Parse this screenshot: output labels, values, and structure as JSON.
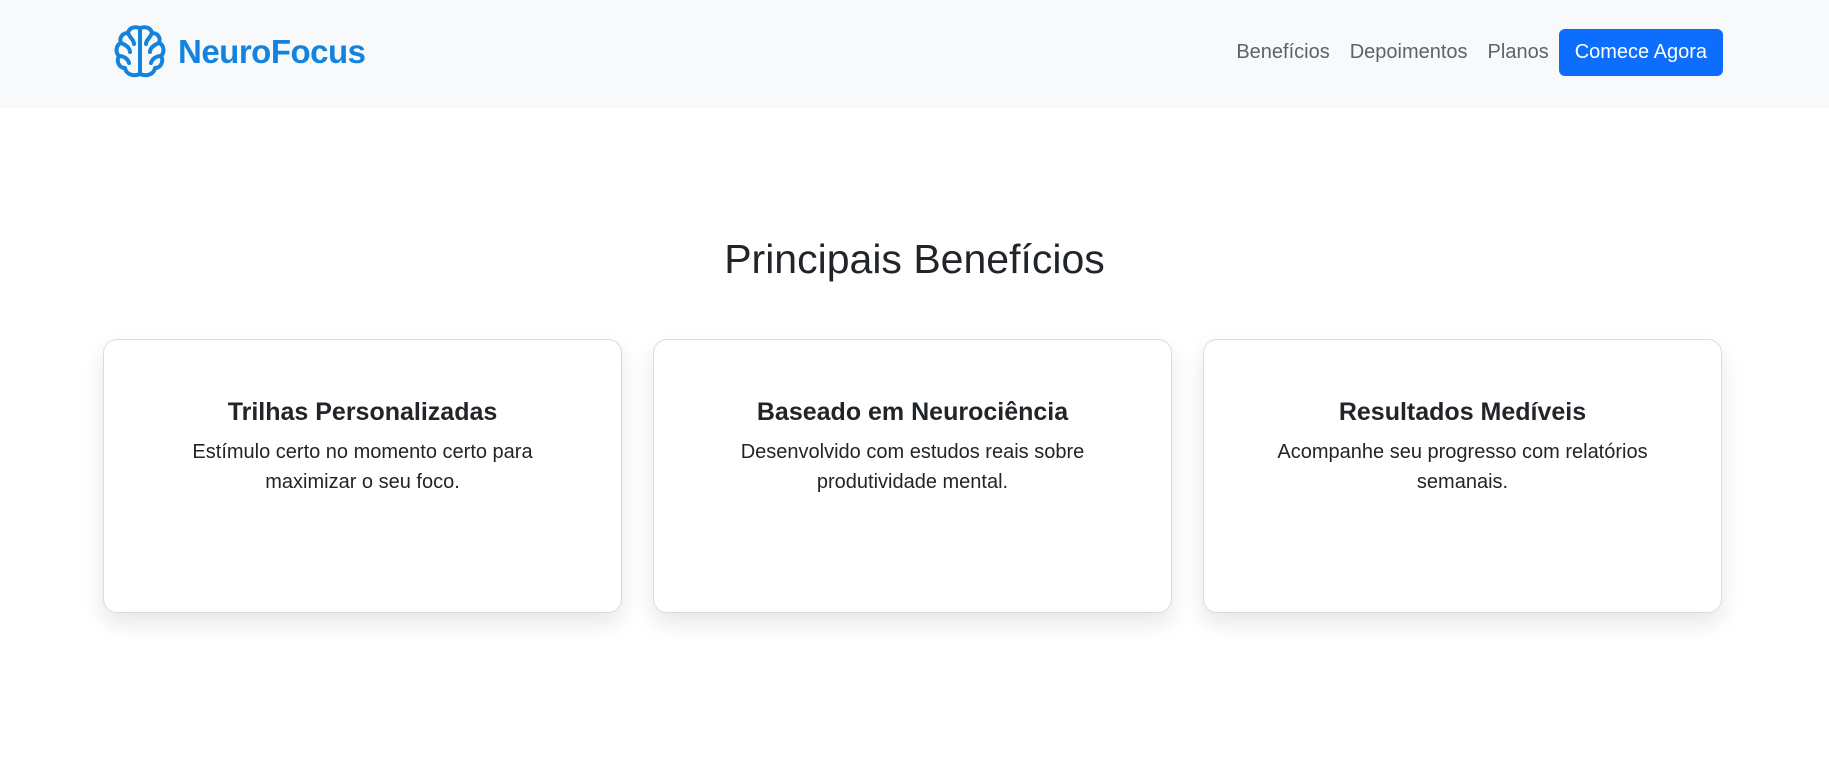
{
  "navbar": {
    "brand_name": "NeuroFocus",
    "brand_icon": "brain-icon",
    "brand_color": "#1483e0",
    "links": [
      "Benefícios",
      "Depoimentos",
      "Planos"
    ],
    "cta_label": "Comece Agora",
    "cta_color": "#0d6efd"
  },
  "benefits": {
    "title": "Principais Benefícios",
    "cards": [
      {
        "title": "Trilhas Personalizadas",
        "text": "Estímulo certo no momento certo para maximizar o seu foco."
      },
      {
        "title": "Baseado em Neurociência",
        "text": "Desenvolvido com estudos reais sobre produtividade mental."
      },
      {
        "title": "Resultados Medíveis",
        "text": "Acompanhe seu progresso com relatórios semanais."
      }
    ]
  }
}
